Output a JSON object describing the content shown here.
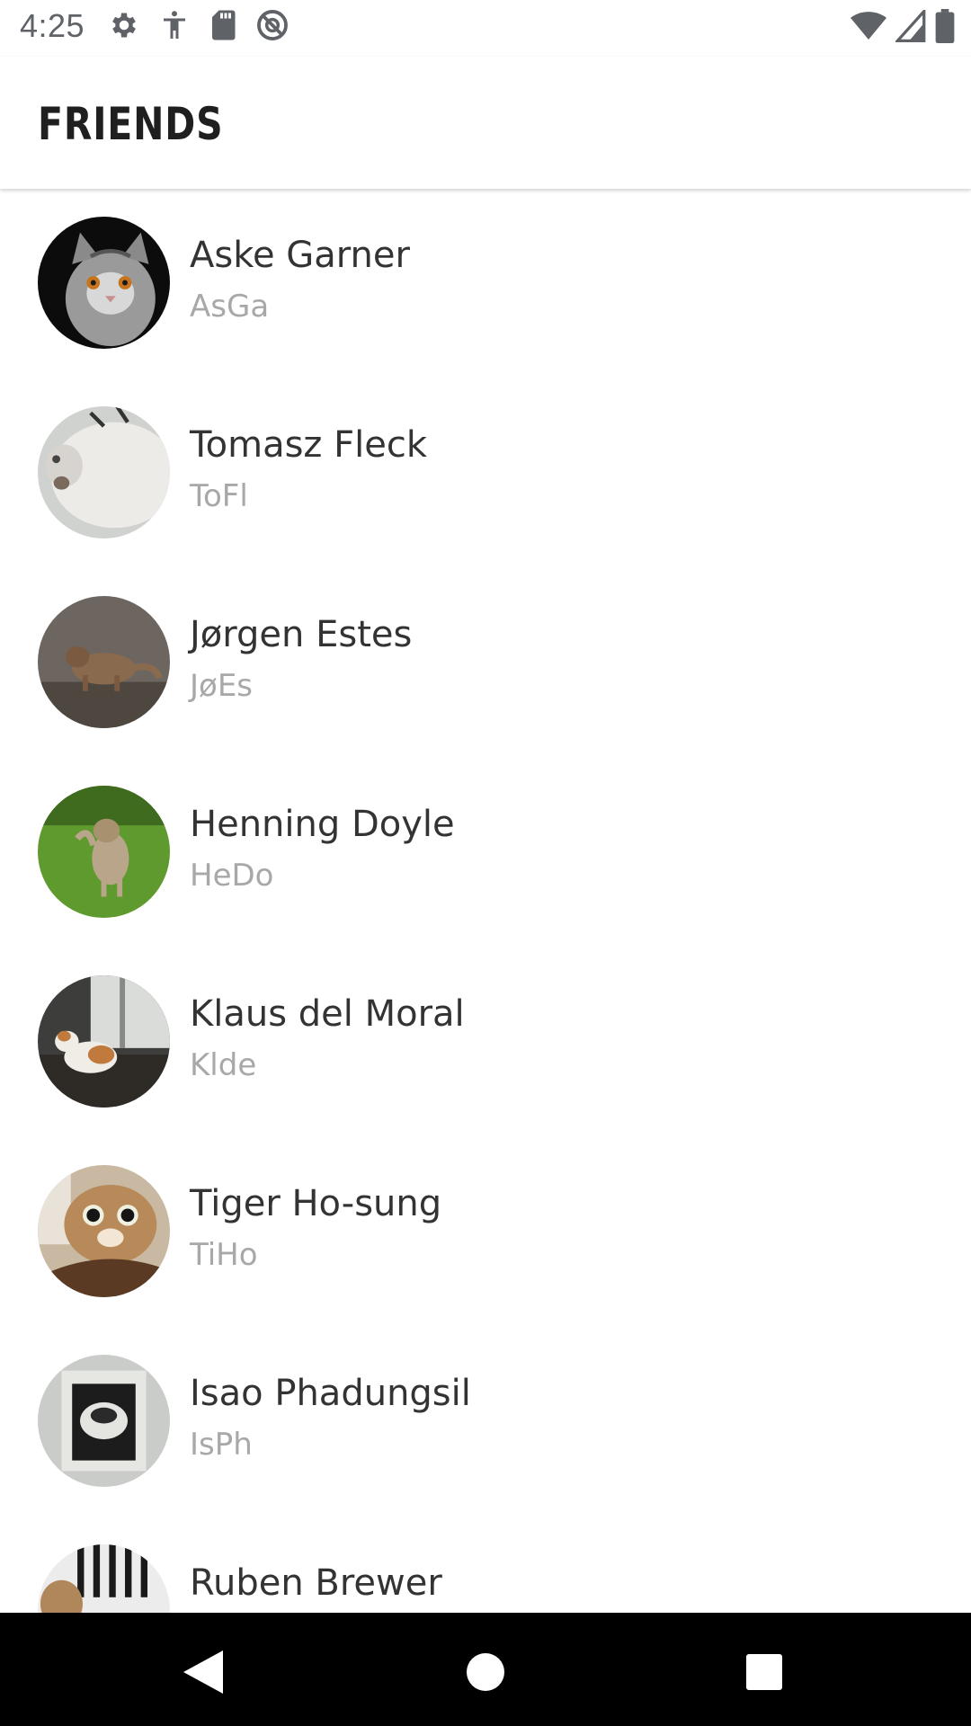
{
  "status_bar": {
    "time": "4:25",
    "left_icons": [
      "gear-icon",
      "accessibility-icon",
      "sd-card-icon",
      "no-disturb-icon"
    ],
    "right_icons": [
      "wifi-icon",
      "cell-signal-icon",
      "battery-icon"
    ]
  },
  "app_bar": {
    "title": "FRIENDS"
  },
  "friends": [
    {
      "name": "Aske Garner",
      "handle": "AsGa",
      "avatar": "cat-photo-avatar"
    },
    {
      "name": "Tomasz Fleck",
      "handle": "ToFl",
      "avatar": "cat-photo-avatar"
    },
    {
      "name": "Jørgen Estes",
      "handle": "JøEs",
      "avatar": "cat-photo-avatar"
    },
    {
      "name": "Henning Doyle",
      "handle": "HeDo",
      "avatar": "cat-photo-avatar"
    },
    {
      "name": "Klaus del Moral",
      "handle": "Klde",
      "avatar": "cat-photo-avatar"
    },
    {
      "name": "Tiger Ho-sung",
      "handle": "TiHo",
      "avatar": "cat-photo-avatar"
    },
    {
      "name": "Isao Phadungsil",
      "handle": "IsPh",
      "avatar": "cat-photo-avatar"
    },
    {
      "name": "Ruben Brewer",
      "handle": "",
      "avatar": "cat-photo-avatar"
    }
  ],
  "nav_bar": {
    "buttons": [
      "back-icon",
      "home-icon",
      "recents-icon"
    ]
  },
  "colors": {
    "background": "#ffffff",
    "title": "#1f1f1f",
    "name": "#333333",
    "handle": "#a8a8a8",
    "status_icons": "#5f6368",
    "nav_bar": "#000000"
  }
}
